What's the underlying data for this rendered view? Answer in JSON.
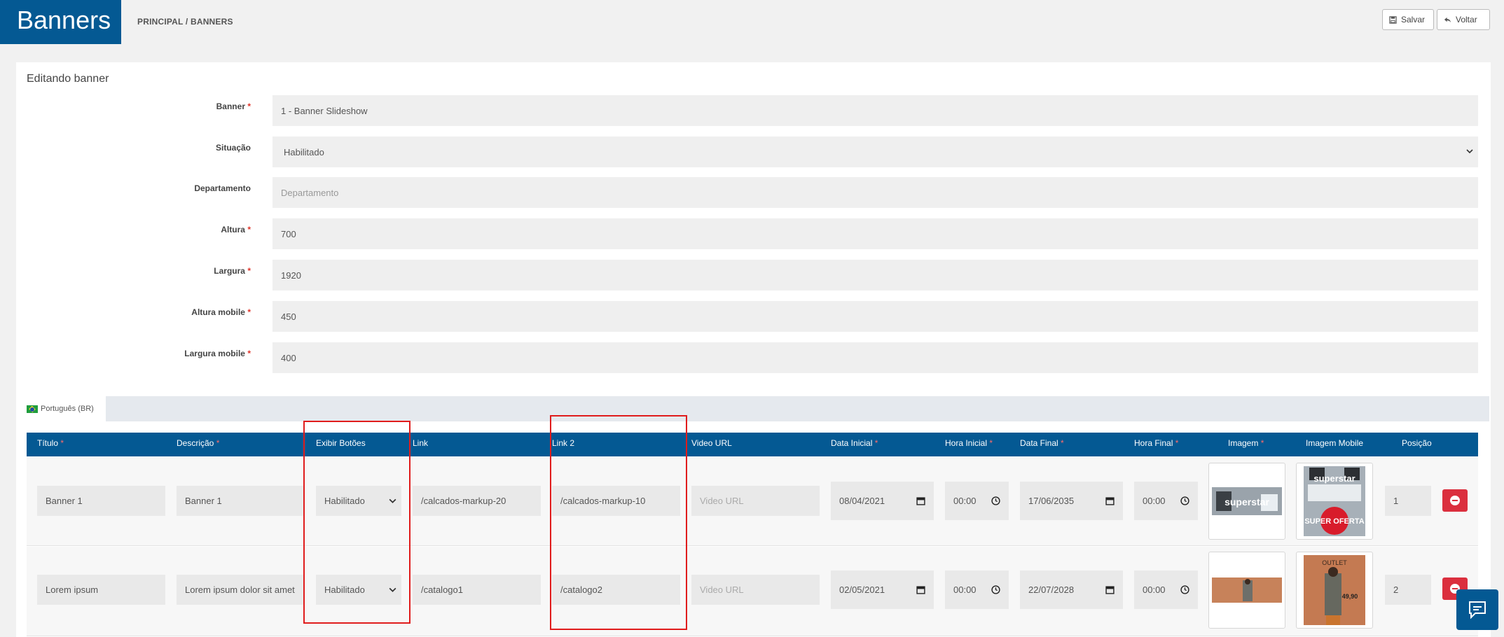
{
  "header": {
    "title": "Banners",
    "breadcrumb": "PRINCIPAL / BANNERS",
    "save_label": "Salvar",
    "back_label": "Voltar"
  },
  "card": {
    "title": "Editando banner"
  },
  "form": {
    "banner": {
      "label": "Banner",
      "value": "1 - Banner Slideshow"
    },
    "situacao": {
      "label": "Situação",
      "value": "Habilitado"
    },
    "departamento": {
      "label": "Departamento",
      "placeholder": "Departamento"
    },
    "altura": {
      "label": "Altura",
      "value": "700"
    },
    "largura": {
      "label": "Largura",
      "value": "1920"
    },
    "altura_mobile": {
      "label": "Altura mobile",
      "value": "450"
    },
    "largura_mobile": {
      "label": "Largura mobile",
      "value": "400"
    },
    "required_mark": "*"
  },
  "language_tab": {
    "label": "Português (BR)"
  },
  "table": {
    "columns": {
      "titulo": "Título",
      "descricao": "Descrição",
      "exibir_botoes": "Exibir Botões",
      "link": "Link",
      "link2": "Link 2",
      "video_url": "Video URL",
      "data_inicial": "Data Inicial",
      "hora_inicial": "Hora Inicial",
      "data_final": "Data Final",
      "hora_final": "Hora Final",
      "imagem": "Imagem",
      "imagem_mobile": "Imagem Mobile",
      "posicao": "Posição"
    },
    "required_mark": "*",
    "video_placeholder": "Video URL",
    "rows": [
      {
        "titulo": "Banner 1",
        "descricao": "Banner 1",
        "exibir_botoes": "Habilitado",
        "link": "/calcados-markup-20",
        "link2": "/calcados-markup-10",
        "data_inicial": "08/04/2021",
        "hora_inicial": "00:00",
        "data_final": "17/06/2035",
        "hora_final": "00:00",
        "posicao": "1",
        "imagem_text": "superstar",
        "imagem_mobile_text": "superstar",
        "imagem_mobile_text2": "SUPER OFERTA"
      },
      {
        "titulo": "Lorem ipsum",
        "descricao": "Lorem ipsum dolor sit amet",
        "exibir_botoes": "Habilitado",
        "link": "/catalogo1",
        "link2": "/catalogo2",
        "data_inicial": "02/05/2021",
        "hora_inicial": "00:00",
        "data_final": "22/07/2028",
        "hora_final": "00:00",
        "posicao": "2",
        "imagem_mobile_text": "OUTLET",
        "imagem_mobile_price": "49,90"
      }
    ]
  },
  "colors": {
    "brand": "#045993",
    "danger": "#db2f3e",
    "highlight": "#e01c1c"
  }
}
